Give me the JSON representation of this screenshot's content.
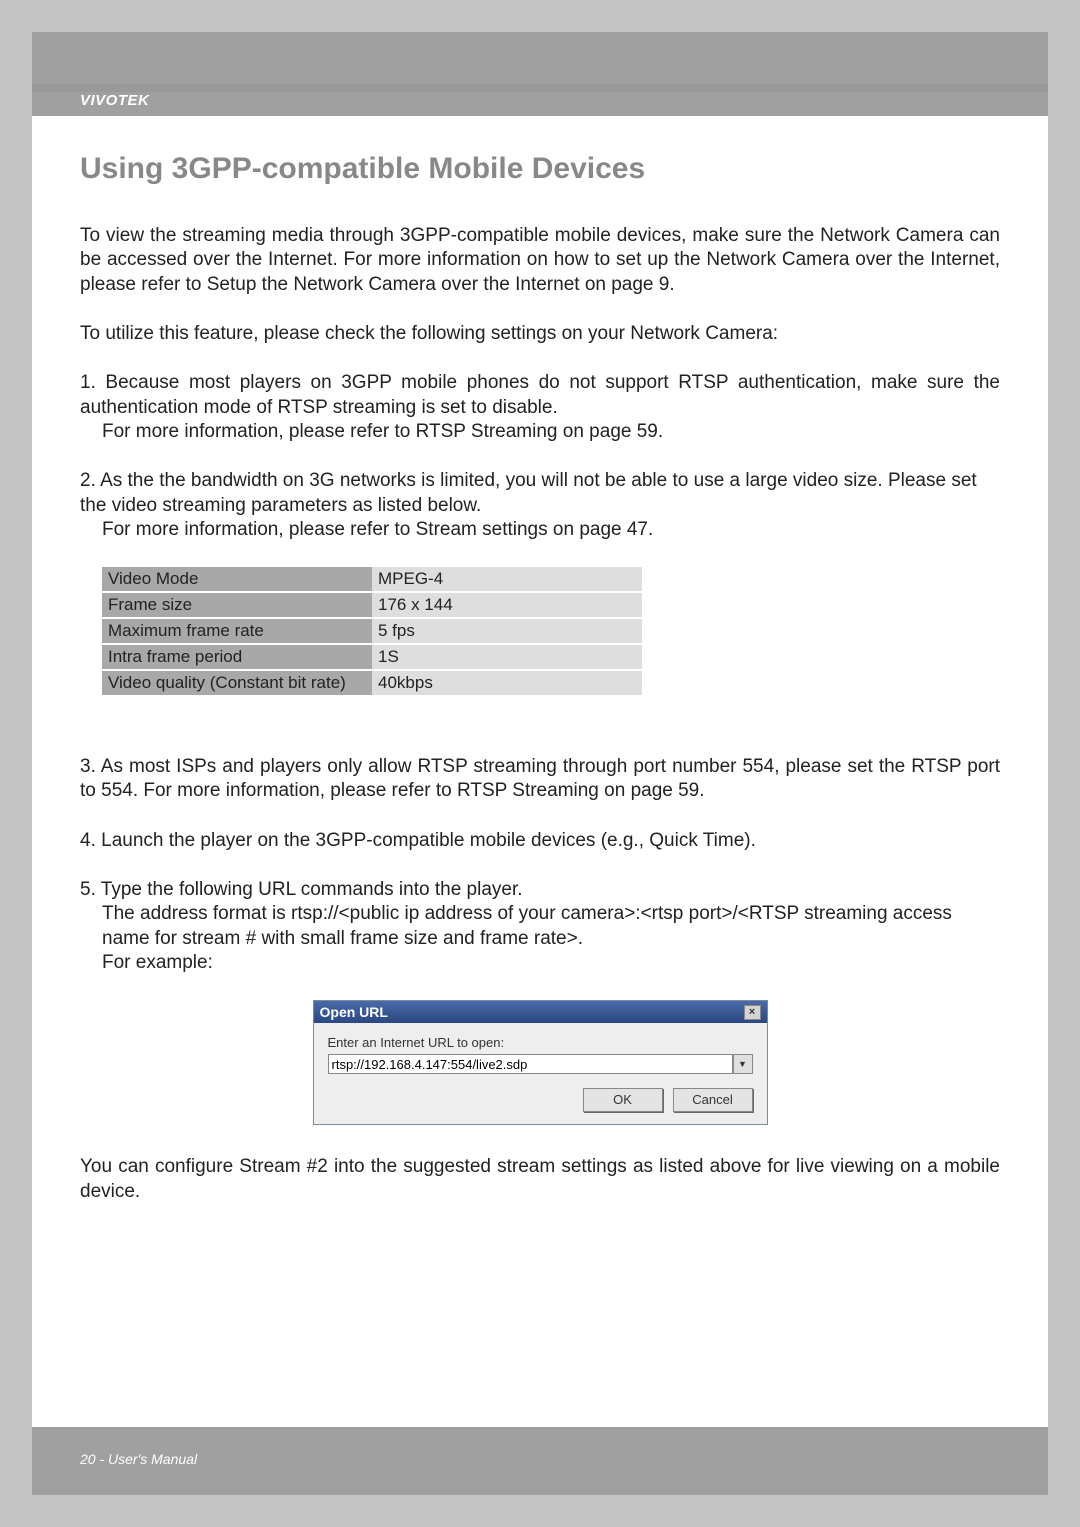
{
  "brand": "VIVOTEK",
  "title": "Using 3GPP-compatible Mobile Devices",
  "para1": "To view the streaming media through 3GPP-compatible mobile devices, make sure the Network Camera can be accessed over the Internet. For more information on how to set up the Network Camera over the Internet, please refer to Setup the Network Camera over the Internet on page 9.",
  "para2": "To utilize this feature, please check the following settings on your Network Camera:",
  "item1_line1": "1. Because most players on 3GPP mobile phones do not support RTSP authentication, make sure the authentication mode of RTSP streaming is set to disable.",
  "item1_line2": "For more information, please refer to RTSP Streaming on page 59.",
  "item2_line1": "2. As the the bandwidth on 3G networks is limited, you will not be able to use a large video size. Please set the video streaming parameters as listed below.",
  "item2_line2": " For more information, please refer to Stream settings on page 47.",
  "table": {
    "rows": [
      {
        "label": "Video Mode",
        "value": "MPEG-4"
      },
      {
        "label": "Frame size",
        "value": "176 x 144"
      },
      {
        "label": "Maximum frame rate",
        "value": "5 fps"
      },
      {
        "label": "Intra frame period",
        "value": "1S"
      },
      {
        "label": "Video quality (Constant bit rate)",
        "value": "40kbps"
      }
    ]
  },
  "item3": "3. As most ISPs and players only allow RTSP streaming through port number 554, please set the RTSP port to 554. For more information, please refer to RTSP Streaming on page 59.",
  "item4": "4. Launch the player on the 3GPP-compatible mobile devices (e.g., Quick Time).",
  "item5_line1": "5. Type the following URL commands into the player.",
  "item5_line2": "The address format is rtsp://<public ip address of your camera>:<rtsp port>/<RTSP streaming access name for stream # with small frame size and frame rate>.",
  "item5_line3": " For example:",
  "dialog": {
    "title": "Open URL",
    "close": "×",
    "label": "Enter an Internet URL to open:",
    "value": "rtsp://192.168.4.147:554/live2.sdp",
    "dropdown": "▼",
    "ok": "OK",
    "cancel": "Cancel"
  },
  "para_after": "You can configure Stream #2 into the suggested stream settings as listed above for live viewing on a mobile device.",
  "footer": "20 - User's Manual"
}
